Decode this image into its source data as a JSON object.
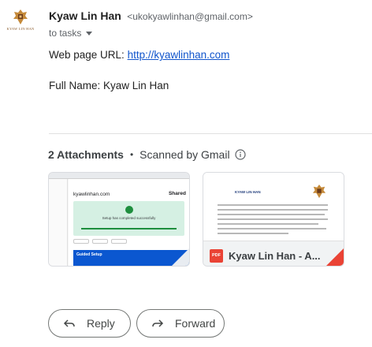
{
  "sender": {
    "name": "Kyaw Lin Han",
    "email": "<ukokyawlinhan@gmail.com>",
    "logo_text": "KYAW LIN HAN"
  },
  "recipient": {
    "label": "to tasks"
  },
  "body": {
    "url_label": "Web page URL: ",
    "url": "http://kyawlinhan.com",
    "name_label": "Full Name: Kyaw Lin Han"
  },
  "attachments": {
    "count_label": "2 Attachments",
    "separator": "•",
    "scan_label": "Scanned by Gmail",
    "items": [
      {
        "type": "image",
        "thumb_domain": "kyawlinhan.com",
        "thumb_shared": "Shared",
        "thumb_message": "Setup has completed successfully",
        "thumb_guided": "Guided Setup"
      },
      {
        "type": "pdf",
        "badge": "PDF",
        "name": "Kyaw Lin Han - A...",
        "thumb_title": "KYAW LIN HAN"
      }
    ]
  },
  "actions": {
    "reply": "Reply",
    "forward": "Forward"
  },
  "colors": {
    "link": "#1155cc",
    "pdf_red": "#ea4335",
    "success_green": "#1e8e3e",
    "guided_blue": "#0b57d0"
  }
}
